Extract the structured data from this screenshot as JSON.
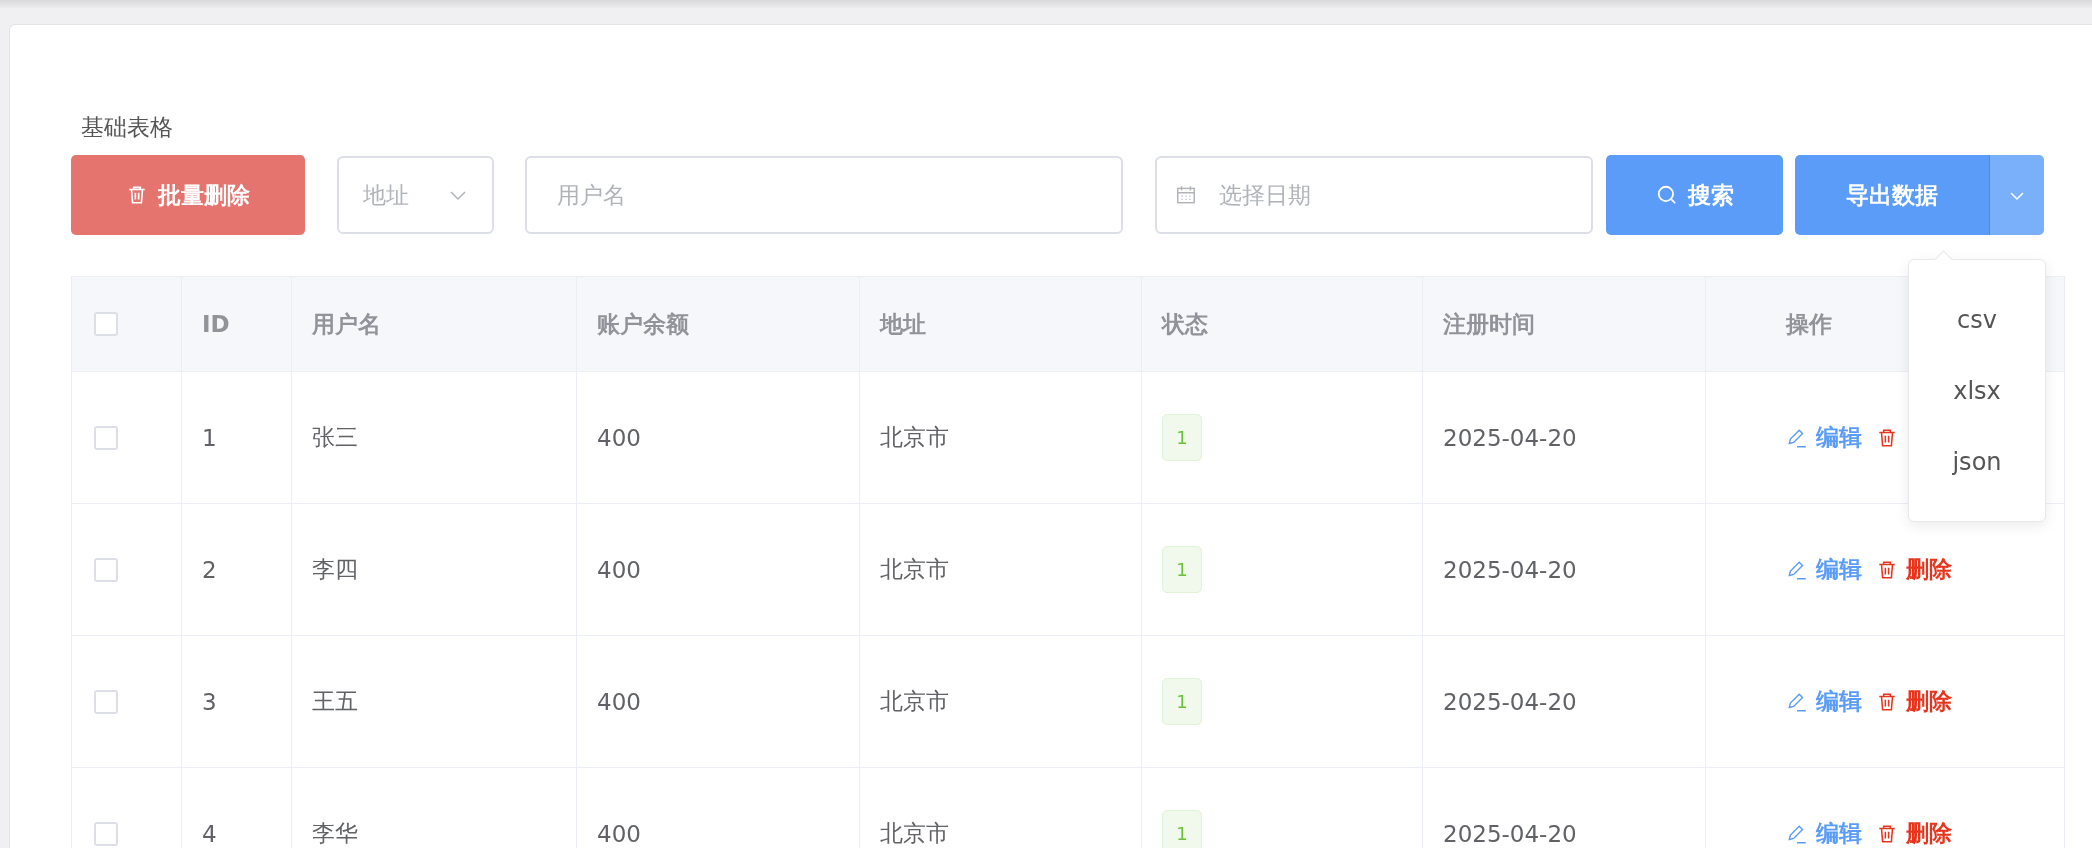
{
  "title": "基础表格",
  "toolbar": {
    "batch_delete": {
      "label": "批量删除",
      "disabled": true
    },
    "address_select": {
      "placeholder": "地址"
    },
    "username": {
      "placeholder": "用户名"
    },
    "date": {
      "placeholder": "选择日期"
    },
    "search": {
      "label": "搜索"
    },
    "export": {
      "label": "导出数据",
      "expanded": true,
      "menu": [
        "csv",
        "xlsx",
        "json"
      ]
    }
  },
  "table": {
    "all_checked": false,
    "columns": [
      "ID",
      "用户名",
      "账户余额",
      "地址",
      "状态",
      "注册时间",
      "操作"
    ],
    "rows": [
      {
        "checked": false,
        "id": "1",
        "username": "张三",
        "balance": "400",
        "address": "北京市",
        "status": "1",
        "registered": "2025-04-20",
        "actions": [
          {
            "kind": "edit",
            "label": "编辑"
          },
          {
            "kind": "delete"
          }
        ]
      },
      {
        "checked": false,
        "id": "2",
        "username": "李四",
        "balance": "400",
        "address": "北京市",
        "status": "1",
        "registered": "2025-04-20",
        "actions": [
          {
            "kind": "edit",
            "label": "编辑"
          },
          {
            "kind": "delete",
            "label": "删除"
          }
        ]
      },
      {
        "checked": false,
        "id": "3",
        "username": "王五",
        "balance": "400",
        "address": "北京市",
        "status": "1",
        "registered": "2025-04-20",
        "actions": [
          {
            "kind": "edit",
            "label": "编辑"
          },
          {
            "kind": "delete",
            "label": "删除"
          }
        ]
      },
      {
        "checked": false,
        "id": "4",
        "username": "李华",
        "balance": "400",
        "address": "北京市",
        "status": "1",
        "registered": "2025-04-20",
        "actions": [
          {
            "kind": "edit",
            "label": "编辑"
          },
          {
            "kind": "delete",
            "label": "删除"
          }
        ]
      }
    ]
  }
}
